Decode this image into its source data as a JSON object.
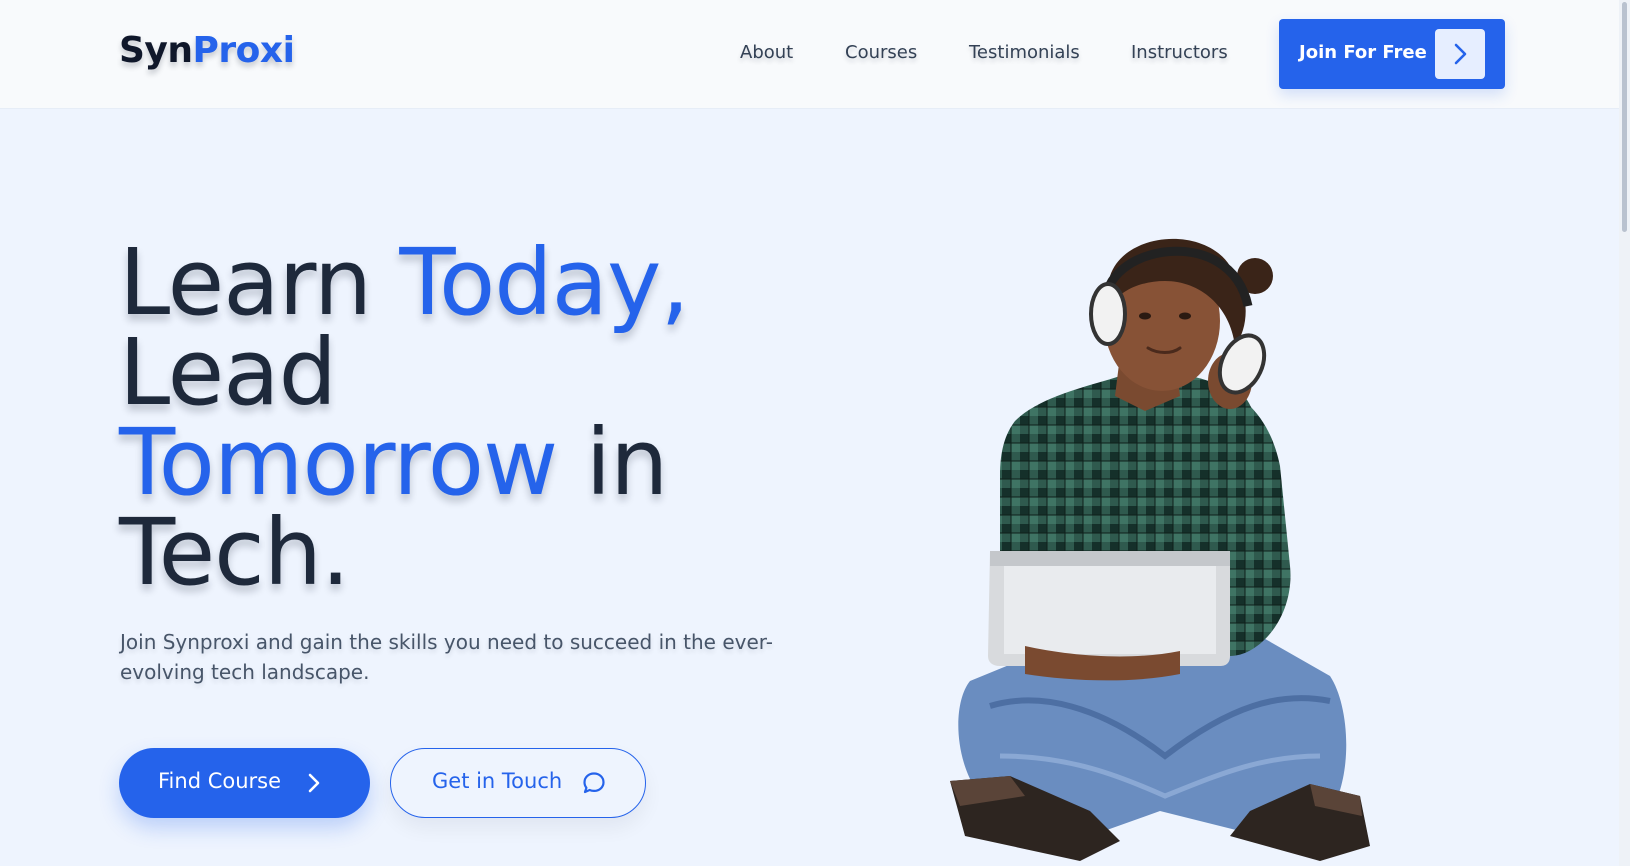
{
  "brand": {
    "logo_part1": "Syn",
    "logo_part2": "Proxi",
    "primary_color": "#2563eb",
    "text_color": "#1e293b",
    "background_color": "#eef4fe"
  },
  "nav": {
    "items": [
      {
        "label": "About"
      },
      {
        "label": "Courses"
      },
      {
        "label": "Testimonials"
      },
      {
        "label": "Instructors"
      }
    ],
    "cta_label": "Join For Free",
    "cta_icon": "chevron-right-icon"
  },
  "hero": {
    "title_word_1": "Learn",
    "title_word_2": "Today,",
    "title_word_3": "Lead",
    "title_word_4": "Tomorrow",
    "title_word_5": "in",
    "title_word_6": "Tech.",
    "subtitle": "Join Synproxi and gain the skills you need to succeed in the ever-evolving tech landscape.",
    "primary_button": {
      "label": "Find Course",
      "icon": "chevron-right-icon"
    },
    "secondary_button": {
      "label": "Get in Touch",
      "icon": "chat-bubble-icon"
    },
    "image_icon": "student-with-headphones-and-laptop"
  }
}
